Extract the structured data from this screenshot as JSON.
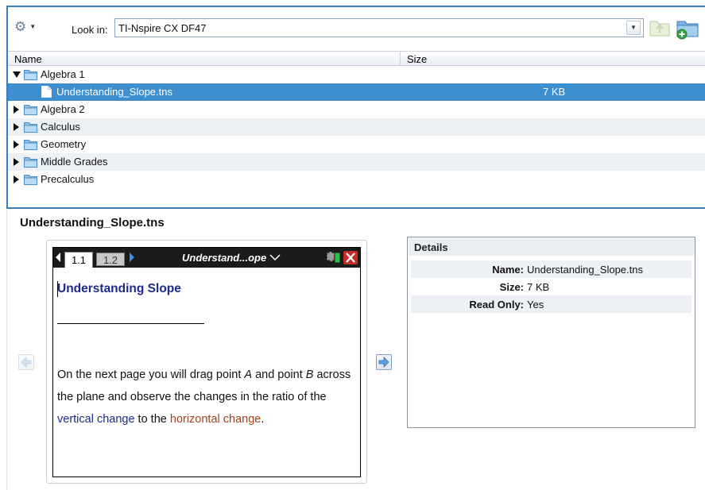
{
  "toolbar": {
    "options_icon": "gear-icon",
    "look_in_label": "Look in:",
    "look_in_value": "TI-Nspire CX DF47"
  },
  "columns": {
    "name": "Name",
    "size": "Size"
  },
  "tree": [
    {
      "label": "Algebra 1",
      "type": "folder",
      "expanded": true
    },
    {
      "label": "Understanding_Slope.tns",
      "type": "file",
      "size": "7 KB",
      "selected": true
    },
    {
      "label": "Algebra 2",
      "type": "folder",
      "expanded": false
    },
    {
      "label": "Calculus",
      "type": "folder",
      "expanded": false
    },
    {
      "label": "Geometry",
      "type": "folder",
      "expanded": false
    },
    {
      "label": "Middle Grades",
      "type": "folder",
      "expanded": false
    },
    {
      "label": "Precalculus",
      "type": "folder",
      "expanded": false
    }
  ],
  "preview": {
    "title": "Understanding_Slope.tns",
    "tabs": [
      "1.1",
      "1.2"
    ],
    "doc_title": "Understand...ope",
    "heading": "Understanding Slope",
    "body": {
      "t1": "On the next page you will drag point ",
      "v1": "A",
      "t2": " and point ",
      "v2": "B",
      "t3": " across the plane and observe the changes in the ratio of the ",
      "k1": "vertical change",
      "t4": " to the ",
      "k2": "horizontal change",
      "t5": "."
    },
    "colors": {
      "heading": "#1c2a8c",
      "vertical": "#1c2a8c",
      "horizontal": "#a3421a"
    }
  },
  "details": {
    "header": "Details",
    "rows": [
      {
        "key": "Name:",
        "value": "Understanding_Slope.tns"
      },
      {
        "key": "Size:",
        "value": "7 KB"
      },
      {
        "key": "Read Only:",
        "value": "Yes"
      }
    ]
  },
  "colors": {
    "selection": "#3d8fd0",
    "border_accent": "#3c7cc0"
  }
}
